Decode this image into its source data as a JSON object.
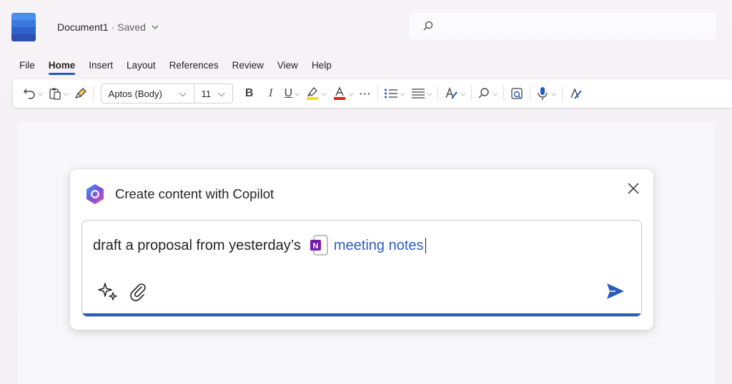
{
  "app": {
    "doc_name": "Document1",
    "separator": "·",
    "save_status": "Saved",
    "brand_colors": [
      "#4a8ef0",
      "#3b78e0",
      "#2f62cb",
      "#2a4fae"
    ]
  },
  "search": {
    "icon": "search-icon"
  },
  "menu": {
    "items": [
      "File",
      "Home",
      "Insert",
      "Layout",
      "References",
      "Review",
      "View",
      "Help"
    ],
    "active": "Home"
  },
  "toolbar": {
    "font_name": "Aptos (Body)",
    "font_size": "11",
    "bold_label": "B",
    "italic_label": "I",
    "underline_label": "U",
    "more_label": "···",
    "icons": [
      "undo-icon",
      "paste-icon",
      "format-painter-icon",
      "highlight-icon",
      "font-color-icon",
      "bullets-icon",
      "align-icon",
      "styles-icon",
      "find-icon",
      "reuse-files-icon",
      "dictate-icon",
      "editor-icon"
    ],
    "highlight_color": "#f5e100",
    "font_color": "#e0231c"
  },
  "copilot": {
    "title": "Create content with Copilot",
    "prompt_text": "draft a proposal from yesterday’s",
    "mention_text": "meeting notes",
    "mention_app_icon": "onenote-icon",
    "accent": "#2b5bbd"
  }
}
